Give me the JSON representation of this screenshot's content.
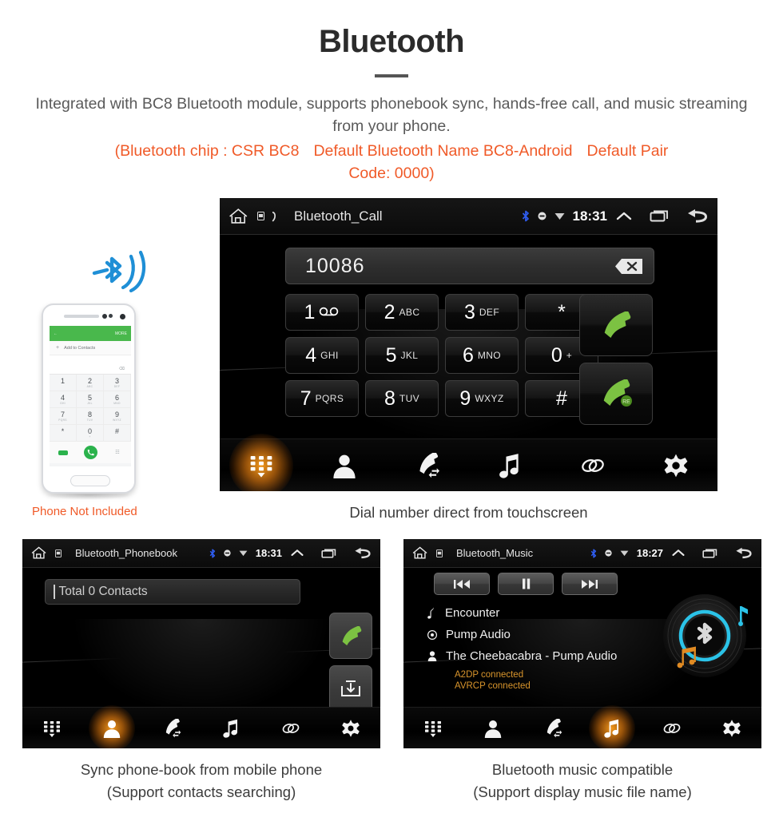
{
  "header": {
    "title": "Bluetooth",
    "description": "Integrated with BC8 Bluetooth module, supports phonebook sync, hands-free call, and music streaming from your phone.",
    "note_line1_a": "(Bluetooth chip : CSR BC8",
    "note_line1_b": "Default Bluetooth Name BC8-Android",
    "note_line1_c": "Default Pair",
    "note_line2": "Code: 0000)",
    "accent_color": "#f05a28",
    "title_color": "#2b2b2b"
  },
  "phone_illustration": {
    "caption": "Phone Not Included",
    "appbar_more": "MORE",
    "add_contacts": "Add to Contacts",
    "backspace": "⌫",
    "keys": [
      {
        "digit": "1",
        "letters": ""
      },
      {
        "digit": "2",
        "letters": "ABC"
      },
      {
        "digit": "3",
        "letters": "DEF"
      },
      {
        "digit": "4",
        "letters": "GHI"
      },
      {
        "digit": "5",
        "letters": "JKL"
      },
      {
        "digit": "6",
        "letters": "MNO"
      },
      {
        "digit": "7",
        "letters": "PQRS"
      },
      {
        "digit": "8",
        "letters": "TUV"
      },
      {
        "digit": "9",
        "letters": "WXYZ"
      },
      {
        "digit": "*",
        "letters": ""
      },
      {
        "digit": "0",
        "letters": "+"
      },
      {
        "digit": "#",
        "letters": ""
      }
    ]
  },
  "call_screen": {
    "statusbar": {
      "title": "Bluetooth_Call",
      "clock": "18:31",
      "icons": [
        "home-icon",
        "sim-icon",
        "phone-handset-icon",
        "bluetooth-icon",
        "sync-icon",
        "wifi-icon",
        "chevron-up-icon",
        "recents-icon",
        "back-icon"
      ]
    },
    "dialed_number": "10086",
    "keys": [
      {
        "digit": "1",
        "letters": "voicemail"
      },
      {
        "digit": "2",
        "letters": "ABC"
      },
      {
        "digit": "3",
        "letters": "DEF"
      },
      {
        "digit": "*",
        "letters": ""
      },
      {
        "digit": "4",
        "letters": "GHI"
      },
      {
        "digit": "5",
        "letters": "JKL"
      },
      {
        "digit": "6",
        "letters": "MNO"
      },
      {
        "digit": "0",
        "letters": "+"
      },
      {
        "digit": "7",
        "letters": "PQRS"
      },
      {
        "digit": "8",
        "letters": "TUV"
      },
      {
        "digit": "9",
        "letters": "WXYZ"
      },
      {
        "digit": "#",
        "letters": ""
      }
    ],
    "answer_button": "call-icon",
    "redial_button": "redial-icon",
    "nav": [
      {
        "name": "keypad",
        "icon": "keypad-icon",
        "active": true
      },
      {
        "name": "contacts",
        "icon": "contact-icon",
        "active": false
      },
      {
        "name": "call-log",
        "icon": "call-log-icon",
        "active": false
      },
      {
        "name": "music",
        "icon": "music-note-icon",
        "active": false
      },
      {
        "name": "link",
        "icon": "link-icon",
        "active": false
      },
      {
        "name": "settings",
        "icon": "gear-icon",
        "active": false
      }
    ],
    "caption": "Dial number direct from touchscreen"
  },
  "phonebook_screen": {
    "statusbar": {
      "title": "Bluetooth_Phonebook",
      "clock": "18:31"
    },
    "search_value": "Total 0 Contacts",
    "call_button": "call-icon",
    "download_button": "download-contacts-icon",
    "nav": [
      {
        "name": "keypad",
        "icon": "keypad-icon",
        "active": false
      },
      {
        "name": "contacts",
        "icon": "contact-icon",
        "active": true
      },
      {
        "name": "call-log",
        "icon": "call-log-icon",
        "active": false
      },
      {
        "name": "music",
        "icon": "music-note-icon",
        "active": false
      },
      {
        "name": "link",
        "icon": "link-icon",
        "active": false
      },
      {
        "name": "settings",
        "icon": "gear-icon",
        "active": false
      }
    ],
    "caption_line1": "Sync phone-book from mobile phone",
    "caption_line2": "(Support contacts searching)"
  },
  "music_screen": {
    "statusbar": {
      "title": "Bluetooth_Music",
      "clock": "18:27"
    },
    "transport": [
      {
        "name": "previous",
        "icon": "prev-track-icon"
      },
      {
        "name": "pause",
        "icon": "pause-icon"
      },
      {
        "name": "next",
        "icon": "next-track-icon"
      }
    ],
    "track_title": "Encounter",
    "album": "Pump Audio",
    "artist": "The Cheebacabra - Pump Audio",
    "status_a2dp": "A2DP connected",
    "status_avrcp": "AVRCP connected",
    "status_color": "#d9952c",
    "nav": [
      {
        "name": "keypad",
        "icon": "keypad-icon",
        "active": false
      },
      {
        "name": "contacts",
        "icon": "contact-icon",
        "active": false
      },
      {
        "name": "call-log",
        "icon": "call-log-icon",
        "active": false
      },
      {
        "name": "music",
        "icon": "music-note-icon",
        "active": true
      },
      {
        "name": "link",
        "icon": "link-icon",
        "active": false
      },
      {
        "name": "settings",
        "icon": "gear-icon",
        "active": false
      }
    ],
    "caption_line1": "Bluetooth music compatible",
    "caption_line2": "(Support display music file name)"
  }
}
